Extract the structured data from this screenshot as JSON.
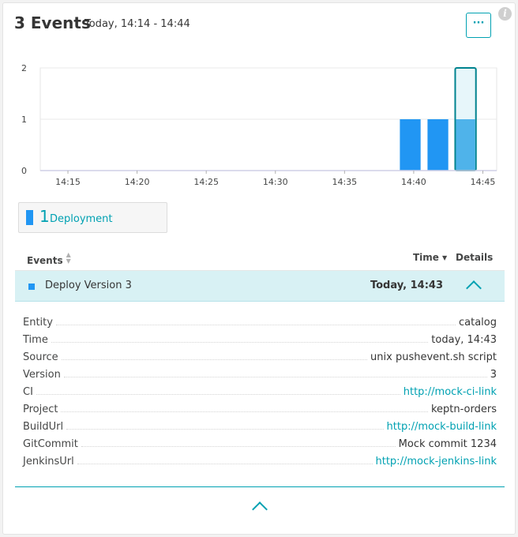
{
  "header": {
    "title": "3 Events",
    "subtitle": "Today, 14:14 - 14:44",
    "menu_label": "···",
    "info_icon": "i"
  },
  "chart_data": {
    "type": "bar",
    "x_ticks": [
      "14:15",
      "14:20",
      "14:25",
      "14:30",
      "14:35",
      "14:40",
      "14:45"
    ],
    "y_ticks": [
      "0",
      "1",
      "2"
    ],
    "ylim": [
      0,
      2
    ],
    "xlim_minutes": [
      "14:13",
      "14:46"
    ],
    "bars": [
      {
        "start": "14:39",
        "end": "14:40.5",
        "value": 1,
        "selected": false
      },
      {
        "start": "14:41",
        "end": "14:42.5",
        "value": 1,
        "selected": false
      },
      {
        "start": "14:43",
        "end": "14:44.5",
        "value": 1,
        "selected": true
      }
    ],
    "grid": true,
    "colors": {
      "bar": "#2196f3",
      "selected_bar": "#4fb3ea",
      "selected_outline": "#00838f",
      "selected_bg": "#e7f6fa"
    }
  },
  "legend": {
    "count": "1",
    "label": "Deployment"
  },
  "table": {
    "col_events": "Events",
    "col_time": "Time",
    "col_details": "Details",
    "row": {
      "name": "Deploy Version 3",
      "time": "Today, 14:43"
    }
  },
  "details": [
    {
      "key": "Entity",
      "value": "catalog",
      "link": false
    },
    {
      "key": "Time",
      "value": "today, 14:43",
      "link": false
    },
    {
      "key": "Source",
      "value": "unix pushevent.sh script",
      "link": false
    },
    {
      "key": "Version",
      "value": "3",
      "link": false
    },
    {
      "key": "CI",
      "value": "http://mock-ci-link",
      "link": true
    },
    {
      "key": "Project",
      "value": "keptn-orders",
      "link": false
    },
    {
      "key": "BuildUrl",
      "value": "http://mock-build-link",
      "link": true
    },
    {
      "key": "GitCommit",
      "value": "Mock commit 1234",
      "link": false
    },
    {
      "key": "JenkinsUrl",
      "value": "http://mock-jenkins-link",
      "link": true
    }
  ],
  "colors": {
    "accent": "#00a1b2",
    "bar": "#2196f3",
    "row_highlight": "#d8f1f4"
  }
}
